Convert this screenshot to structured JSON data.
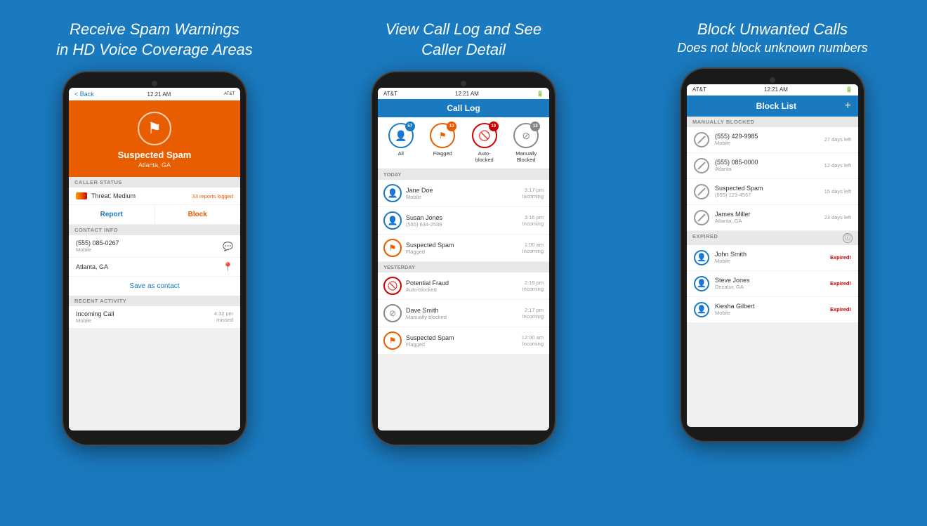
{
  "panels": [
    {
      "id": "panel1",
      "title_line1": "Receive Spam Warnings",
      "title_line2": "in HD Voice Coverage Areas",
      "screen": {
        "status_bar": {
          "carrier": "AT&T",
          "time": "12:21 AM",
          "signal": "●●●●○"
        },
        "nav": {
          "back_label": "< Back"
        },
        "header": {
          "icon": "🏴",
          "title": "Suspected Spam",
          "subtitle": "Atlanta, GA"
        },
        "caller_status": {
          "section": "CALLER STATUS",
          "threat": "Threat: Medium",
          "reports": "33 reports logged",
          "report_btn": "Report",
          "block_btn": "Block"
        },
        "contact_info": {
          "section": "CONTACT INFO",
          "phone": "(555) 085-0267",
          "phone_type": "Mobile",
          "location": "Atlanta, GA",
          "save_label": "Save as contact"
        },
        "recent_activity": {
          "section": "RECENT ACTIVITY",
          "call_type": "Incoming Call",
          "call_sub": "Mobile",
          "call_time": "4:32 pm",
          "call_status": "missed"
        }
      }
    },
    {
      "id": "panel2",
      "title_line1": "View Call Log and See",
      "title_line2": "Caller Detail",
      "screen": {
        "status_bar": {
          "carrier": "AT&T",
          "time": "12:21 AM"
        },
        "header": {
          "title": "Call Log"
        },
        "filters": [
          {
            "label": "All",
            "badge": "57",
            "color": "blue",
            "icon": "👤"
          },
          {
            "label": "Flagged",
            "badge": "13",
            "color": "orange",
            "icon": "🏴"
          },
          {
            "label": "Auto-\nblocked",
            "badge": "19",
            "color": "red",
            "icon": "🚫"
          },
          {
            "label": "Manually\nBlocked",
            "badge": "13",
            "color": "gray",
            "icon": "⊘"
          }
        ],
        "today": {
          "section": "TODAY",
          "calls": [
            {
              "name": "Jane Doe",
              "sub": "Mobile",
              "time": "3:17 pm",
              "direction": "Incoming",
              "type": "person"
            },
            {
              "name": "Susan Jones",
              "sub": "(555) 634-2538",
              "time": "3:16 pm",
              "direction": "Incoming",
              "type": "person"
            },
            {
              "name": "Suspected Spam",
              "sub": "Flagged",
              "time": "1:00 am",
              "direction": "Incoming",
              "type": "flag"
            }
          ]
        },
        "yesterday": {
          "section": "YESTERDAY",
          "calls": [
            {
              "name": "Potential Fraud",
              "sub": "Auto-blocked",
              "time": "2:19 pm",
              "direction": "Incoming",
              "type": "block-red"
            },
            {
              "name": "Dave Smith",
              "sub": "Manually blocked",
              "time": "2:17 pm",
              "direction": "Incoming",
              "type": "block-gray"
            },
            {
              "name": "Suspected Spam",
              "sub": "Flagged",
              "time": "12:00 am",
              "direction": "Incoming",
              "type": "flag"
            }
          ]
        }
      }
    },
    {
      "id": "panel3",
      "title_line1": "Block Unwanted Calls",
      "title_line2": "Does not block unknown numbers",
      "screen": {
        "status_bar": {
          "carrier": "AT&T",
          "time": "12:21 AM"
        },
        "header": {
          "title": "Block List",
          "add_btn": "+"
        },
        "manually_blocked": {
          "section": "MANUALLY BLOCKED",
          "items": [
            {
              "name": "(555) 429-9985",
              "sub": "Mobile",
              "days": "27 days left"
            },
            {
              "name": "(555) 085-0000",
              "sub": "Atlanta",
              "days": "12 days left"
            },
            {
              "name": "Suspected Spam",
              "sub": "(555) 123-4567",
              "days": "15 days left"
            },
            {
              "name": "James Miller",
              "sub": "Atlanta, GA",
              "days": "23 days left"
            }
          ]
        },
        "expired": {
          "section": "EXPIRED",
          "items": [
            {
              "name": "John Smith",
              "sub": "Mobile",
              "status": "Expired!"
            },
            {
              "name": "Steve Jones",
              "sub": "Decatur, GA",
              "status": "Expired!"
            },
            {
              "name": "Kiesha Gilbert",
              "sub": "Mobile",
              "status": "Expired!"
            }
          ]
        }
      }
    }
  ],
  "colors": {
    "blue": "#1a7abf",
    "orange": "#e85d00",
    "red": "#cc0000",
    "gray": "#888888",
    "bg_panel": "#1a7abf"
  }
}
